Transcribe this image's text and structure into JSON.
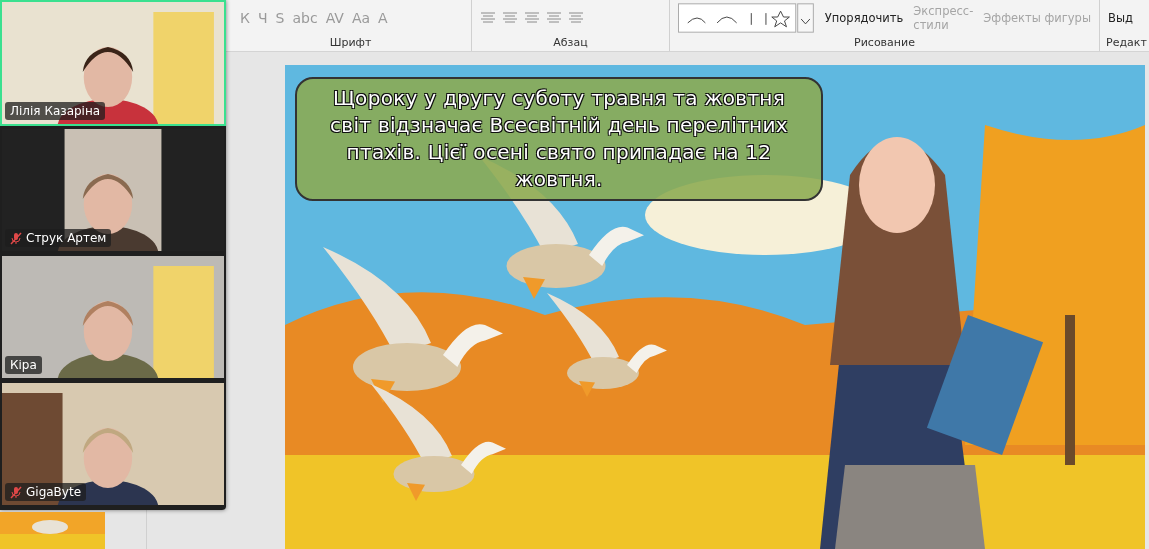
{
  "ribbon": {
    "font_buttons": [
      {
        "label": "К",
        "disabled": true
      },
      {
        "label": "Ч",
        "disabled": true
      },
      {
        "label": "S",
        "disabled": true
      },
      {
        "label": "abc",
        "disabled": true
      },
      {
        "label": "AV",
        "disabled": true
      },
      {
        "label": "Aa",
        "disabled": true
      },
      {
        "label": "A",
        "disabled": true
      }
    ],
    "groups": [
      {
        "label": "Шрифт"
      },
      {
        "label": "Абзац"
      },
      {
        "label": "Рисование"
      },
      {
        "label": "Редакт"
      }
    ],
    "arrange": {
      "label": "Упорядочить",
      "disabled": false
    },
    "quick_styles": {
      "lines": [
        "Экспресс-",
        "стили"
      ],
      "disabled": true
    },
    "shape_effects": {
      "label": "Эффекты фигуры",
      "disabled": true
    },
    "select": {
      "label": "Выд"
    }
  },
  "participants": [
    {
      "name": "Лілія Казаріна",
      "muted": false,
      "speaking": true
    },
    {
      "name": "Струк Артем",
      "muted": true,
      "speaking": false
    },
    {
      "name": "Кіра",
      "muted": false,
      "speaking": false
    },
    {
      "name": "GigaByte",
      "muted": true,
      "speaking": false
    }
  ],
  "slide": {
    "text": "Щороку у другу суботу травня та жовтня світ відзначає Всесвітній день перелітних птахів. Цієї осені свято припадає на 12 жовтня."
  }
}
